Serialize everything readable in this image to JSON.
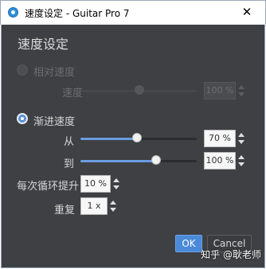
{
  "window": {
    "title": "速度设定 - Guitar Pro 7",
    "close_glyph": "✕"
  },
  "dialog": {
    "title": "速度设定",
    "relative_speed": {
      "label": "相对速度",
      "enabled": false,
      "checked": false,
      "speed_label": "速度",
      "speed_value": "100 %"
    },
    "progressive_speed": {
      "label": "渐进速度",
      "checked": true,
      "from_label": "从",
      "from_value": "70 %",
      "from_level": 0.7,
      "to_label": "到",
      "to_value": "100 %",
      "to_level": 1.0,
      "increase_label": "每次循环提升",
      "increase_value": "10 %",
      "repeat_label": "重复",
      "repeat_value": "1 x"
    },
    "ok_label": "OK",
    "cancel_label": "Cancel"
  },
  "watermark": "知乎 @耿老师",
  "colors": {
    "dialog_bg": "#3e4043",
    "accent": "#4a8ad8",
    "slider_fill": "#6a9ce0"
  }
}
